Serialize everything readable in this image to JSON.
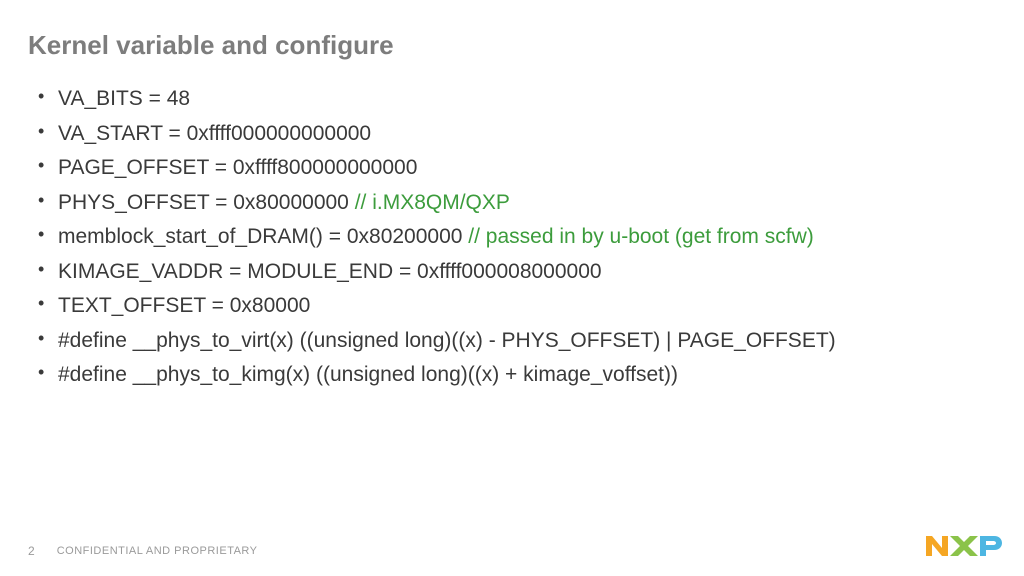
{
  "title": "Kernel variable and configure",
  "bullets": [
    {
      "text": "VA_BITS = 48",
      "comment": ""
    },
    {
      "text": "VA_START = 0xffff000000000000",
      "comment": ""
    },
    {
      "text": "PAGE_OFFSET = 0xffff800000000000",
      "comment": ""
    },
    {
      "text": "PHYS_OFFSET = 0x80000000 ",
      "comment": "// i.MX8QM/QXP"
    },
    {
      "text": "memblock_start_of_DRAM() = 0x80200000 ",
      "comment": "// passed in by u-boot (get from scfw)"
    },
    {
      "text": "KIMAGE_VADDR = MODULE_END = 0xffff000008000000",
      "comment": ""
    },
    {
      "text": "TEXT_OFFSET = 0x80000",
      "comment": ""
    },
    {
      "text": "#define __phys_to_virt(x)       ((unsigned long)((x) - PHYS_OFFSET) | PAGE_OFFSET)",
      "comment": ""
    },
    {
      "text": "#define __phys_to_kimg(x)       ((unsigned long)((x) + kimage_voffset))",
      "comment": ""
    }
  ],
  "footer": {
    "page": "2",
    "confidential": "CONFIDENTIAL AND PROPRIETARY"
  },
  "logo": {
    "name": "NXP"
  }
}
